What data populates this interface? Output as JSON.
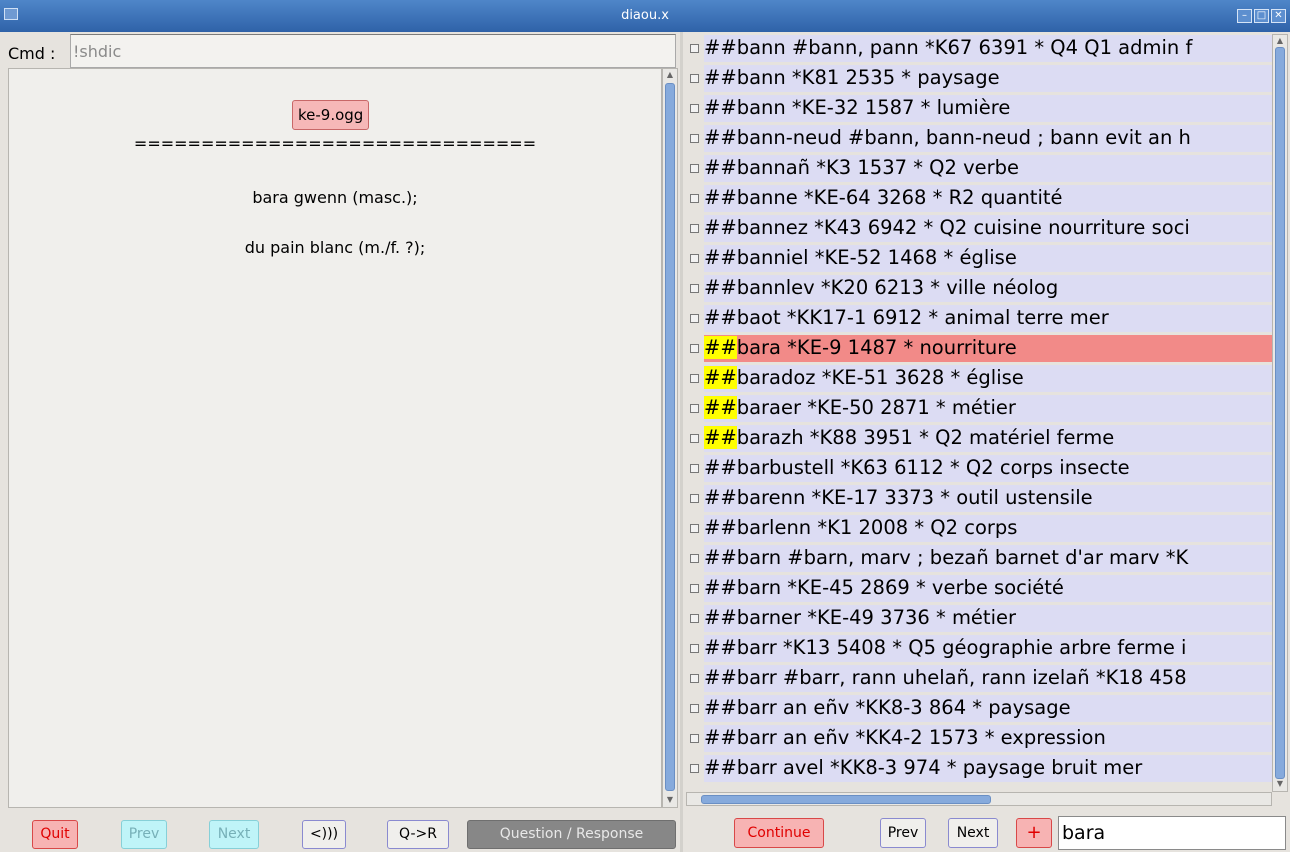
{
  "window": {
    "title": "diaou.x"
  },
  "left": {
    "cmd_label": "Cmd :",
    "cmd_value": "!shdic",
    "audio_file": "ke-9.ogg",
    "separator": "==============================",
    "def_breton": "bara gwenn (masc.);",
    "def_french": "du pain blanc (m./f. ?);",
    "buttons": {
      "quit": "Quit",
      "prev": "Prev",
      "next": "Next",
      "play": "<)))",
      "qr": "Q->R",
      "question_response": "Question / Response"
    }
  },
  "right": {
    "rows": [
      {
        "prefix": "##",
        "text": "bann #bann, pann *K67 6391 * Q4 Q1 admin f",
        "highlight": false,
        "selected": false
      },
      {
        "prefix": "##",
        "text": "bann *K81 2535 * paysage",
        "highlight": false,
        "selected": false
      },
      {
        "prefix": "##",
        "text": "bann *KE-32 1587 * lumière",
        "highlight": false,
        "selected": false
      },
      {
        "prefix": "##",
        "text": "bann-neud #bann, bann-neud ; bann evit an h",
        "highlight": false,
        "selected": false
      },
      {
        "prefix": "##",
        "text": "bannañ *K3 1537 * Q2 verbe",
        "highlight": false,
        "selected": false
      },
      {
        "prefix": "##",
        "text": "banne *KE-64 3268 * R2 quantité",
        "highlight": false,
        "selected": false
      },
      {
        "prefix": "##",
        "text": "bannez *K43 6942 * Q2 cuisine nourriture soci",
        "highlight": false,
        "selected": false
      },
      {
        "prefix": "##",
        "text": "banniel *KE-52 1468 * église",
        "highlight": false,
        "selected": false
      },
      {
        "prefix": "##",
        "text": "bannlev *K20 6213 * ville néolog",
        "highlight": false,
        "selected": false
      },
      {
        "prefix": "##",
        "text": "baot *KK17-1 6912 * animal terre mer",
        "highlight": false,
        "selected": false
      },
      {
        "prefix": "##",
        "text": "bara *KE-9 1487 * nourriture",
        "highlight": true,
        "selected": true
      },
      {
        "prefix": "##",
        "text": "baradoz *KE-51 3628 * église",
        "highlight": true,
        "selected": false
      },
      {
        "prefix": "##",
        "text": "baraer *KE-50 2871 * métier",
        "highlight": true,
        "selected": false
      },
      {
        "prefix": "##",
        "text": "barazh *K88 3951 * Q2 matériel ferme",
        "highlight": true,
        "selected": false
      },
      {
        "prefix": "##",
        "text": "barbustell *K63 6112 * Q2 corps insecte",
        "highlight": false,
        "selected": false
      },
      {
        "prefix": "##",
        "text": "barenn *KE-17 3373 * outil ustensile",
        "highlight": false,
        "selected": false
      },
      {
        "prefix": "##",
        "text": "barlenn *K1 2008 * Q2 corps",
        "highlight": false,
        "selected": false
      },
      {
        "prefix": "##",
        "text": "barn #barn, marv ; bezañ barnet d'ar marv *K",
        "highlight": false,
        "selected": false
      },
      {
        "prefix": "##",
        "text": "barn *KE-45 2869 * verbe société",
        "highlight": false,
        "selected": false
      },
      {
        "prefix": "##",
        "text": "barner *KE-49 3736 * métier",
        "highlight": false,
        "selected": false
      },
      {
        "prefix": "##",
        "text": "barr *K13 5408 * Q5 géographie arbre ferme i",
        "highlight": false,
        "selected": false
      },
      {
        "prefix": "##",
        "text": "barr #barr, rann uhelañ, rann izelañ *K18 458",
        "highlight": false,
        "selected": false
      },
      {
        "prefix": "##",
        "text": "barr an eñv *KK8-3 864 * paysage",
        "highlight": false,
        "selected": false
      },
      {
        "prefix": "##",
        "text": "barr an eñv *KK4-2 1573 * expression",
        "highlight": false,
        "selected": false
      },
      {
        "prefix": "##",
        "text": "barr avel *KK8-3 974 * paysage bruit mer",
        "highlight": false,
        "selected": false
      }
    ],
    "buttons": {
      "continue": "Continue",
      "prev": "Prev",
      "next": "Next",
      "add": "+"
    },
    "search_value": "bara"
  },
  "colors": {
    "selected_row": "#f28a88",
    "highlight": "#ffff00",
    "row_bg": "#dcdcf3",
    "title_bar": "#3f74bb"
  }
}
